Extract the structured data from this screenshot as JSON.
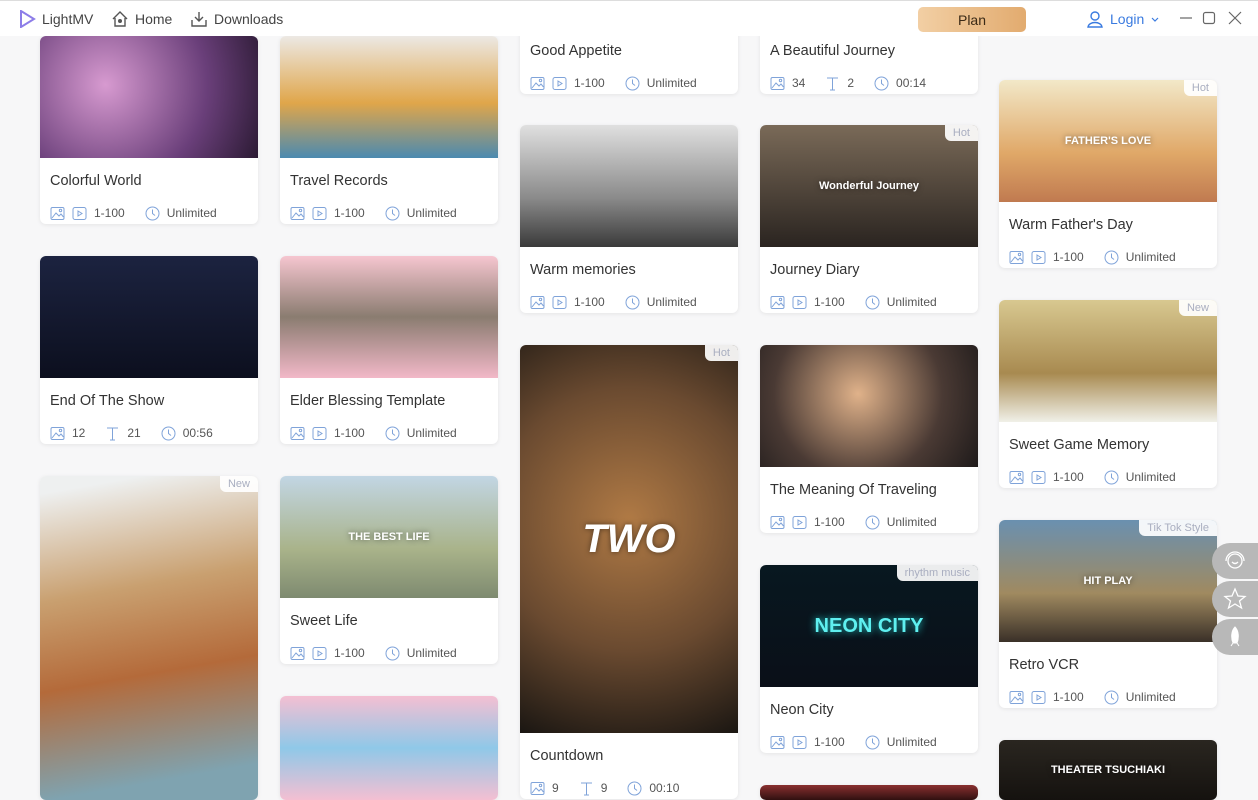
{
  "header": {
    "app_name": "LightMV",
    "nav": [
      {
        "label": "Home",
        "icon": "home-icon"
      },
      {
        "label": "Downloads",
        "icon": "download-icon"
      }
    ],
    "plan_label": "Plan",
    "login_label": "Login"
  },
  "colors": {
    "accent": "#3a7be0",
    "meta_icon": "#7fa3d9",
    "plan_gradient": [
      "#f2cfa4",
      "#e2ab6f"
    ]
  },
  "side_buttons": [
    {
      "icon": "support-icon"
    },
    {
      "icon": "star-icon"
    },
    {
      "icon": "rocket-icon"
    }
  ],
  "cards": [
    {
      "title": "Colorful World",
      "badge": "",
      "thumb_text": "",
      "meta": [
        {
          "icons": [
            "image",
            "video"
          ],
          "value": "1-100"
        },
        {
          "icons": [
            "clock"
          ],
          "value": "Unlimited"
        }
      ]
    },
    {
      "title": "End Of The Show",
      "badge": "",
      "thumb_text": "",
      "meta": [
        {
          "icons": [
            "image"
          ],
          "value": "12"
        },
        {
          "icons": [
            "text"
          ],
          "value": "21"
        },
        {
          "icons": [
            "clock"
          ],
          "value": "00:56"
        }
      ]
    },
    {
      "title": "",
      "badge": "New",
      "thumb_text": "",
      "meta": []
    },
    {
      "title": "Travel Records",
      "badge": "",
      "thumb_text": "",
      "meta": [
        {
          "icons": [
            "image",
            "video"
          ],
          "value": "1-100"
        },
        {
          "icons": [
            "clock"
          ],
          "value": "Unlimited"
        }
      ]
    },
    {
      "title": "Elder Blessing Template",
      "badge": "",
      "thumb_text": "",
      "meta": [
        {
          "icons": [
            "image",
            "video"
          ],
          "value": "1-100"
        },
        {
          "icons": [
            "clock"
          ],
          "value": "Unlimited"
        }
      ]
    },
    {
      "title": "Sweet Life",
      "badge": "",
      "thumb_text": "THE BEST LIFE",
      "meta": [
        {
          "icons": [
            "image",
            "video"
          ],
          "value": "1-100"
        },
        {
          "icons": [
            "clock"
          ],
          "value": "Unlimited"
        }
      ]
    },
    {
      "title": "",
      "badge": "",
      "thumb_text": "",
      "meta": []
    },
    {
      "title": "Good Appetite",
      "badge": "",
      "thumb_text": "",
      "meta": [
        {
          "icons": [
            "image",
            "video"
          ],
          "value": "1-100"
        },
        {
          "icons": [
            "clock"
          ],
          "value": "Unlimited"
        }
      ]
    },
    {
      "title": "Warm memories",
      "badge": "",
      "thumb_text": "",
      "meta": [
        {
          "icons": [
            "image",
            "video"
          ],
          "value": "1-100"
        },
        {
          "icons": [
            "clock"
          ],
          "value": "Unlimited"
        }
      ]
    },
    {
      "title": "Countdown",
      "badge": "Hot",
      "thumb_text": "TWO",
      "meta": [
        {
          "icons": [
            "image"
          ],
          "value": "9"
        },
        {
          "icons": [
            "text"
          ],
          "value": "9"
        },
        {
          "icons": [
            "clock"
          ],
          "value": "00:10"
        }
      ]
    },
    {
      "title": "A Beautiful Journey",
      "badge": "",
      "thumb_text": "",
      "meta": [
        {
          "icons": [
            "image"
          ],
          "value": "34"
        },
        {
          "icons": [
            "text"
          ],
          "value": "2"
        },
        {
          "icons": [
            "clock"
          ],
          "value": "00:14"
        }
      ]
    },
    {
      "title": "Journey Diary",
      "badge": "Hot",
      "thumb_text": "Wonderful Journey",
      "meta": [
        {
          "icons": [
            "image",
            "video"
          ],
          "value": "1-100"
        },
        {
          "icons": [
            "clock"
          ],
          "value": "Unlimited"
        }
      ]
    },
    {
      "title": "The Meaning Of Traveling",
      "badge": "",
      "thumb_text": "",
      "meta": [
        {
          "icons": [
            "image",
            "video"
          ],
          "value": "1-100"
        },
        {
          "icons": [
            "clock"
          ],
          "value": "Unlimited"
        }
      ]
    },
    {
      "title": "Neon City",
      "badge": "rhythm music",
      "thumb_text": "NEON CITY",
      "meta": [
        {
          "icons": [
            "image",
            "video"
          ],
          "value": "1-100"
        },
        {
          "icons": [
            "clock"
          ],
          "value": "Unlimited"
        }
      ]
    },
    {
      "title": "",
      "badge": "",
      "thumb_text": "",
      "meta": []
    },
    {
      "title": "",
      "badge": "",
      "thumb_text": "",
      "meta": [
        {
          "icons": [
            "image",
            "video"
          ],
          "value": "1-100"
        },
        {
          "icons": [
            "clock"
          ],
          "value": "Unlimited"
        }
      ]
    },
    {
      "title": "Warm Father's Day",
      "badge": "Hot",
      "thumb_text": "FATHER'S LOVE",
      "meta": [
        {
          "icons": [
            "image",
            "video"
          ],
          "value": "1-100"
        },
        {
          "icons": [
            "clock"
          ],
          "value": "Unlimited"
        }
      ]
    },
    {
      "title": "Sweet Game Memory",
      "badge": "New",
      "thumb_text": "",
      "meta": [
        {
          "icons": [
            "image",
            "video"
          ],
          "value": "1-100"
        },
        {
          "icons": [
            "clock"
          ],
          "value": "Unlimited"
        }
      ]
    },
    {
      "title": "Retro VCR",
      "badge": "Tik Tok Style",
      "thumb_text": "HIT PLAY",
      "meta": [
        {
          "icons": [
            "image",
            "video"
          ],
          "value": "1-100"
        },
        {
          "icons": [
            "clock"
          ],
          "value": "Unlimited"
        }
      ]
    },
    {
      "title": "",
      "badge": "",
      "thumb_text": "THEATER TSUCHIAKI",
      "meta": []
    }
  ]
}
